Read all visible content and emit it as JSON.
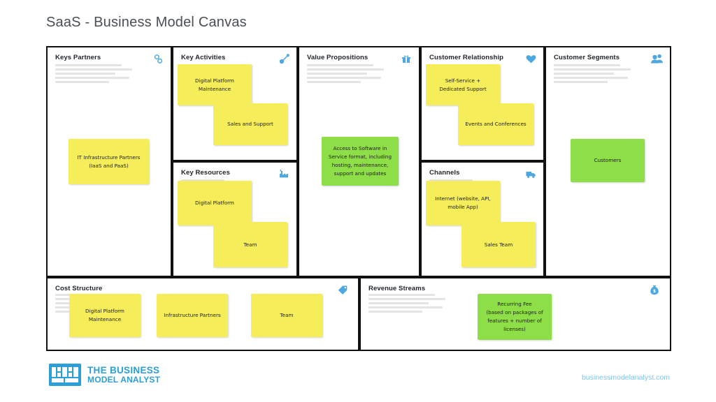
{
  "page": {
    "title": "SaaS - Business Model Canvas",
    "colors": {
      "note_yellow": "#f6ed5a",
      "note_green": "#8ede48",
      "icon_blue": "#4ea8e0",
      "brand_blue": "#2c9fd6",
      "border": "#111111",
      "title_text": "#4a4f54"
    }
  },
  "blocks": {
    "key_partners": {
      "title": "Keys Partners",
      "icon": "chain-link-icon",
      "notes": [
        {
          "text": "IT Infrastructure Partners\n(IaaS and PaaS)",
          "color": "yellow"
        }
      ]
    },
    "key_activities": {
      "title": "Key Activities",
      "icon": "key-icon",
      "notes": [
        {
          "text": "Digital Platform\nMaintenance",
          "color": "yellow"
        },
        {
          "text": "Sales and Support",
          "color": "yellow"
        }
      ]
    },
    "key_resources": {
      "title": "Key Resources",
      "icon": "factory-icon",
      "notes": [
        {
          "text": "Digital Platform",
          "color": "yellow"
        },
        {
          "text": "Team",
          "color": "yellow"
        }
      ]
    },
    "value_propositions": {
      "title": "Value Propositions",
      "icon": "gift-icon",
      "notes": [
        {
          "text": "Access to Software in\nService format, including\nhosting, maintenance,\nsupport and updates",
          "color": "green"
        }
      ]
    },
    "customer_relationship": {
      "title": "Customer Relationship",
      "icon": "heart-icon",
      "notes": [
        {
          "text": "Self-Service +\nDedicated Support",
          "color": "yellow"
        },
        {
          "text": "Events and Conferences",
          "color": "yellow"
        }
      ]
    },
    "channels": {
      "title": "Channels",
      "icon": "truck-icon",
      "notes": [
        {
          "text": "Internet (website, API,\nmobile App)",
          "color": "yellow"
        },
        {
          "text": "Sales Team",
          "color": "yellow"
        }
      ]
    },
    "customer_segments": {
      "title": "Customer Segments",
      "icon": "people-icon",
      "notes": [
        {
          "text": "Customers",
          "color": "green"
        }
      ]
    },
    "cost_structure": {
      "title": "Cost Structure",
      "icon": "price-tag-icon",
      "notes": [
        {
          "text": "Digital Platform\nMaintenance",
          "color": "yellow"
        },
        {
          "text": "Infrastructure Partners",
          "color": "yellow"
        },
        {
          "text": "Team",
          "color": "yellow"
        }
      ]
    },
    "revenue_streams": {
      "title": "Revenue Streams",
      "icon": "money-bag-icon",
      "notes": [
        {
          "text": "Recurring Fee\n(based on packages of\nfeatures + number of\nlicenses)",
          "color": "green"
        }
      ]
    }
  },
  "footer": {
    "logo_line1": "THE BUSINESS",
    "logo_line2": "MODEL ANALYST",
    "website": "businessmodelanalyst.com"
  }
}
